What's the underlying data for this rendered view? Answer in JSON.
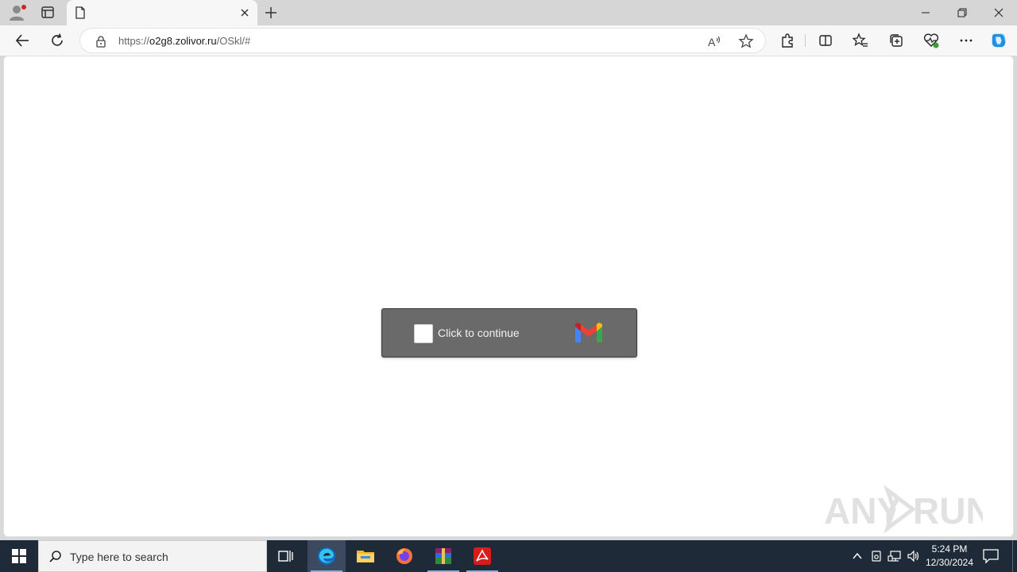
{
  "browser": {
    "tab_title": "",
    "url_domain_prefix": "https://",
    "url_host": "o2g8.zolivor.ru",
    "url_path": "/OSkl/#"
  },
  "page": {
    "captcha_label": "Click to continue",
    "logo": "gmail-m-logo"
  },
  "watermark": {
    "text": "ANY RUN"
  },
  "taskbar": {
    "search_placeholder": "Type here to search",
    "time": "5:24 PM",
    "date": "12/30/2024",
    "apps": [
      "task-view",
      "edge",
      "file-explorer",
      "firefox",
      "winrar",
      "acrobat"
    ]
  },
  "colors": {
    "taskbar": "#1f2a38",
    "captcha_bg": "#6a6a6a",
    "accent": "#0f6cbd"
  }
}
